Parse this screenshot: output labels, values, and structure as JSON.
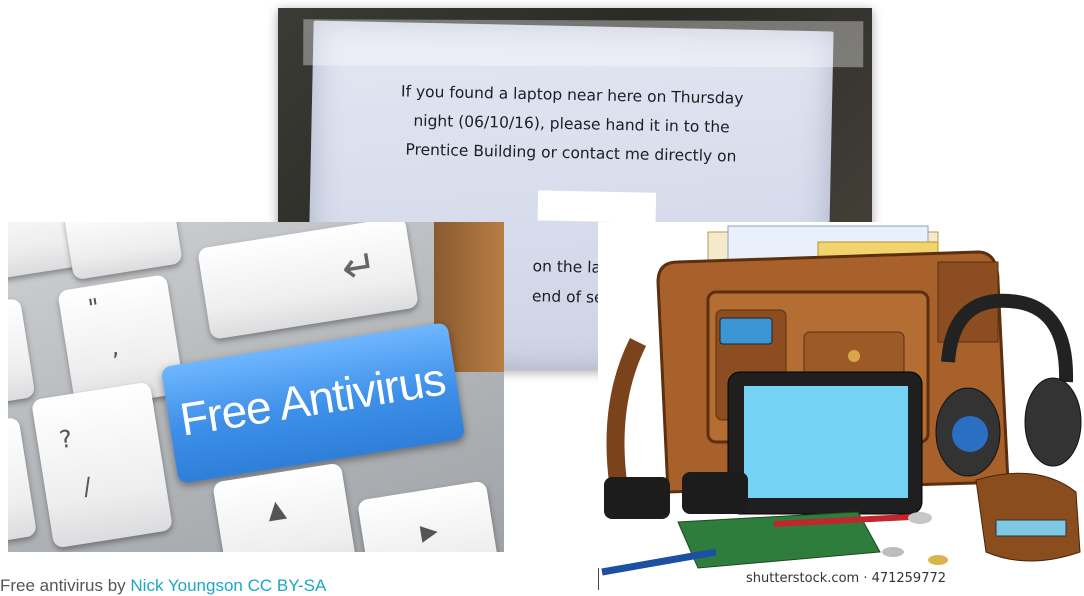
{
  "note_photo": {
    "lines": [
      "If you found a laptop near here on Thursday",
      "night (06/10/16), please hand it in to the",
      "Prentice Building or contact me directly on"
    ],
    "partial_lines": [
      "on the lap",
      "end of sen"
    ]
  },
  "keyboard_photo": {
    "key_label": "Free Antivirus",
    "glyphs": [
      "\"",
      ",",
      "?",
      "/",
      "↵",
      "▲",
      "▶"
    ]
  },
  "bag_illustration": {
    "watermark": "shutterstock.com · 471259772"
  },
  "caption": {
    "prefix": "Free antivirus by ",
    "link_text": "Nick Youngson CC BY-SA"
  },
  "colors": {
    "link": "#1aa7c9",
    "key_blue": "#3d8fe8",
    "leather": "#a8612a"
  }
}
